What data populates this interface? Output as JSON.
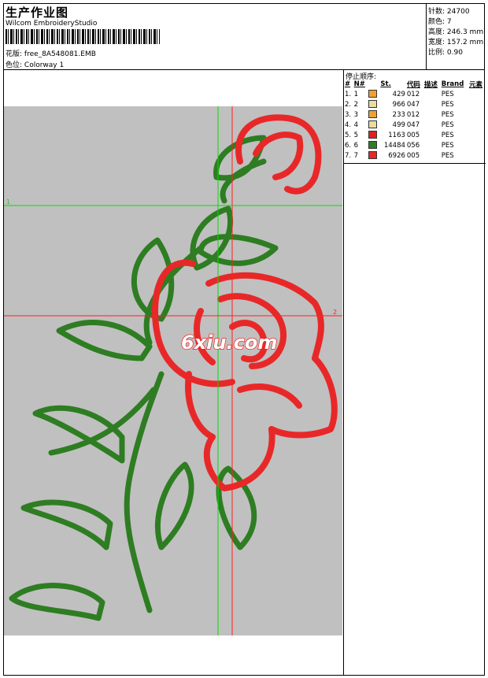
{
  "header": {
    "title": "生产作业图",
    "software": "Wilcom EmbroideryStudio",
    "design_label": "花版:",
    "design_value": "free_8A548081.EMB",
    "colorway_label": "色位:",
    "colorway_value": "Colorway 1"
  },
  "stats": [
    {
      "label": "针数:",
      "value": "24700"
    },
    {
      "label": "颜色:",
      "value": "7"
    },
    {
      "label": "高度:",
      "value": "246.3 mm"
    },
    {
      "label": "宽度:",
      "value": "157.2 mm"
    },
    {
      "label": "比例:",
      "value": "0.90"
    }
  ],
  "sequence": {
    "title": "停止顺序:",
    "columns": [
      "#",
      "N#",
      "",
      "St.",
      "代码",
      "描述",
      "Brand",
      "元素"
    ],
    "rows": [
      {
        "idx": "1.",
        "n": "1",
        "color": "#f0a030",
        "st": "429",
        "code": "012",
        "brand": "PES"
      },
      {
        "idx": "2.",
        "n": "2",
        "color": "#e8dca0",
        "st": "966",
        "code": "047",
        "brand": "PES"
      },
      {
        "idx": "3.",
        "n": "3",
        "color": "#f0a030",
        "st": "233",
        "code": "012",
        "brand": "PES"
      },
      {
        "idx": "4.",
        "n": "4",
        "color": "#e8dca0",
        "st": "499",
        "code": "047",
        "brand": "PES"
      },
      {
        "idx": "5.",
        "n": "5",
        "color": "#e02020",
        "st": "1163",
        "code": "005",
        "brand": "PES"
      },
      {
        "idx": "6.",
        "n": "6",
        "color": "#2e7d22",
        "st": "14484",
        "code": "056",
        "brand": "PES"
      },
      {
        "idx": "7.",
        "n": "7",
        "color": "#e82828",
        "st": "6926",
        "code": "005",
        "brand": "PES"
      }
    ]
  },
  "canvas": {
    "guide_h_label": "1",
    "guide_v_label": "2",
    "watermark": "6xiu.com",
    "background": "#c0c0c0",
    "guide_green": "#00e000",
    "guide_red": "#ff2020",
    "stem_color": "#2e7d22",
    "petal_color": "#e82828"
  }
}
